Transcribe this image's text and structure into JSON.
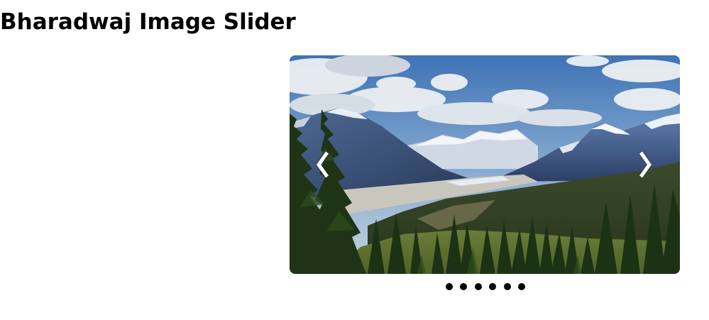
{
  "page": {
    "title": "Bharadwaj Image Slider"
  },
  "slider": {
    "image_subject": "mountain-landscape",
    "prev_icon": "chevron-left-icon",
    "next_icon": "chevron-right-icon",
    "arrow_color": "#ffffff",
    "slide_count": 6,
    "dot_color": "#000000"
  }
}
